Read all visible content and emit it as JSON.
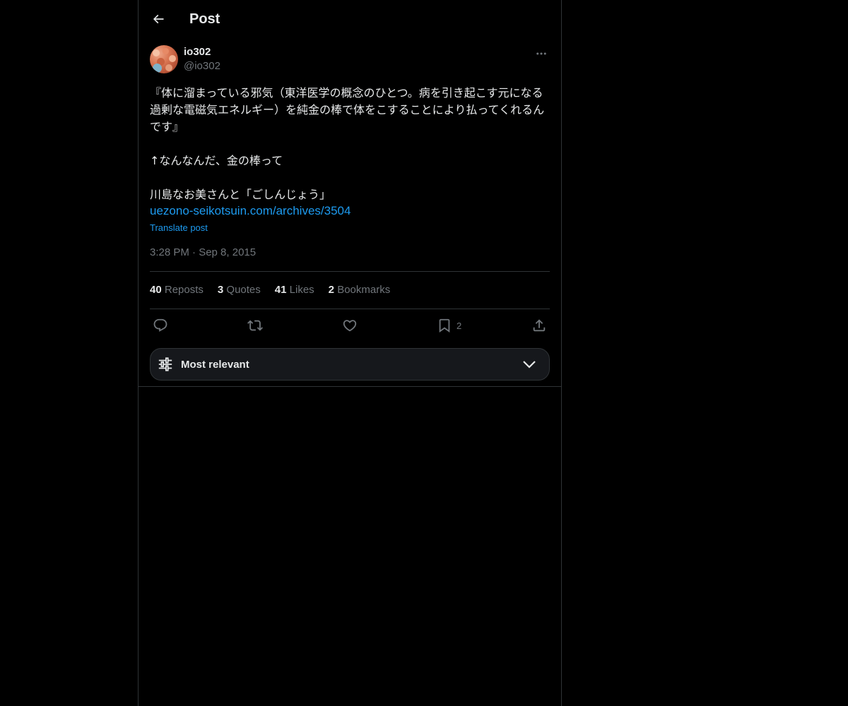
{
  "header": {
    "title": "Post",
    "back_icon": "arrow-left-icon"
  },
  "post": {
    "author": {
      "name": "io302",
      "handle": "@io302"
    },
    "text": "『体に溜まっている邪気（東洋医学の概念のひとつ。病を引き起こす元になる過剰な電磁気エネルギー）を純金の棒で体をこすることにより払ってくれるんです』\n\n↑なんなんだ、金の棒って\n\n川島なお美さんと「ごしんじょう」",
    "link": "uezono-seikotsuin.com/archives/3504",
    "translate_label": "Translate post",
    "timestamp": "3:28 PM · Sep 8, 2015"
  },
  "stats": [
    {
      "count": "40",
      "label": "Reposts"
    },
    {
      "count": "3",
      "label": "Quotes"
    },
    {
      "count": "41",
      "label": "Likes"
    },
    {
      "count": "2",
      "label": "Bookmarks"
    }
  ],
  "actions": {
    "reply_icon": "reply-icon",
    "repost_icon": "repost-icon",
    "like_icon": "heart-icon",
    "bookmark_icon": "bookmark-icon",
    "bookmark_count": "2",
    "share_icon": "share-icon"
  },
  "sort": {
    "label": "Most relevant"
  },
  "colors": {
    "background": "#000000",
    "text": "#e7e9ea",
    "muted": "#71767b",
    "link": "#1d9bf0",
    "border": "#2f3336"
  }
}
